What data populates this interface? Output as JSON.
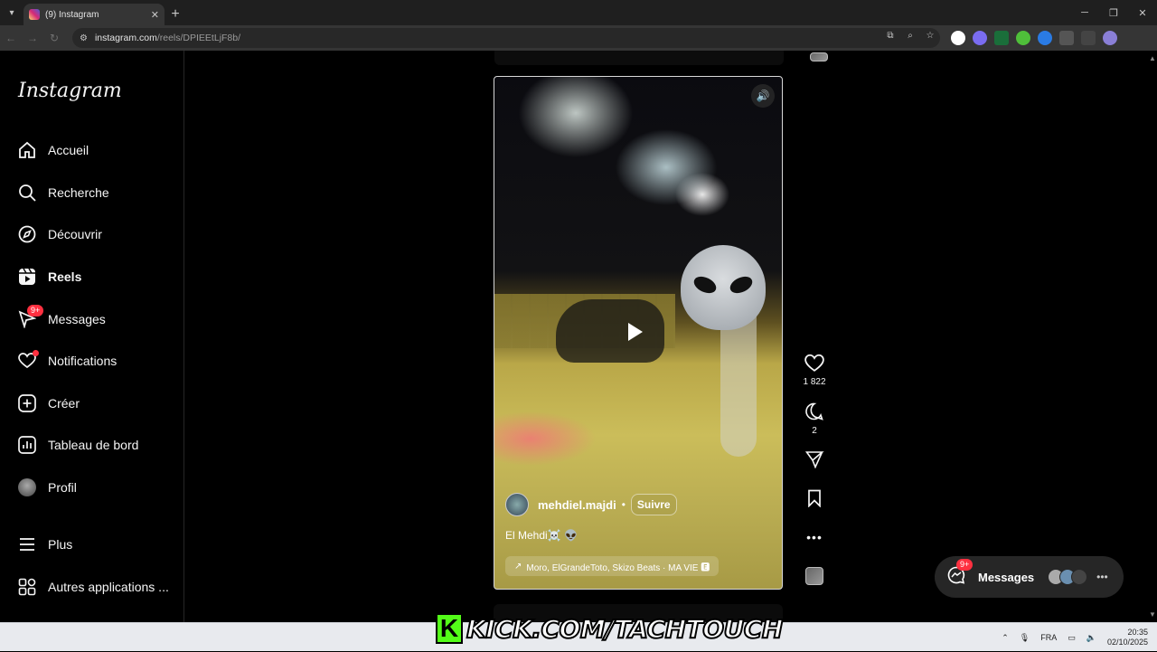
{
  "browser": {
    "tab_title": "(9) Instagram",
    "url_domain": "instagram.com",
    "url_path": "/reels/DPIEEtLjF8b/"
  },
  "sidebar": {
    "logo": "Instagram",
    "items": [
      {
        "label": "Accueil",
        "icon": "home-icon"
      },
      {
        "label": "Recherche",
        "icon": "search-icon"
      },
      {
        "label": "Découvrir",
        "icon": "compass-icon"
      },
      {
        "label": "Reels",
        "icon": "reels-icon",
        "active": true
      },
      {
        "label": "Messages",
        "icon": "messenger-icon",
        "badge": "9+"
      },
      {
        "label": "Notifications",
        "icon": "heart-icon",
        "dot": true
      },
      {
        "label": "Créer",
        "icon": "plus-square-icon"
      },
      {
        "label": "Tableau de bord",
        "icon": "dashboard-icon"
      },
      {
        "label": "Profil",
        "icon": "avatar"
      },
      {
        "label": "Plus",
        "icon": "menu-icon"
      },
      {
        "label": "Autres applications ...",
        "icon": "apps-icon"
      }
    ]
  },
  "reel": {
    "username": "mehdiel.majdi",
    "separator": "•",
    "follow_label": "Suivre",
    "caption": "El Mehdi☠️ 👽",
    "audio": "Moro, ElGrandeToto, Skizo Beats · MA VIE 🅴"
  },
  "actions": {
    "likes": "1 822",
    "comments": "2"
  },
  "messages_bar": {
    "label": "Messages",
    "badge": "9+"
  },
  "overlay": {
    "k": "K",
    "text": "KICK.COM/TACHTOUCH"
  },
  "taskbar": {
    "lang": "FRA",
    "time": "20:35",
    "date": "02/10/2025"
  }
}
